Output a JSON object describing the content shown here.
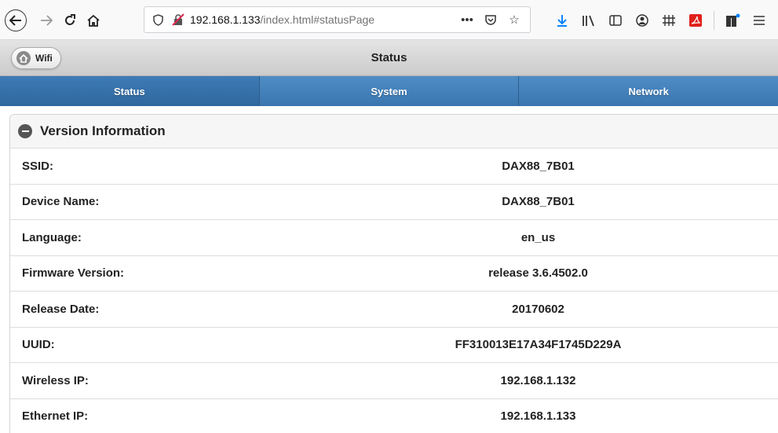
{
  "browser": {
    "url_host": "192.168.1.133",
    "url_path": "/index.html#statusPage",
    "icons": [
      "back-icon",
      "forward-icon",
      "reload-icon",
      "home-icon",
      "tracking-shield-icon",
      "insecure-connection-icon",
      "page-actions-icon",
      "pocket-icon",
      "bookmark-star-icon",
      "download-icon",
      "library-icon",
      "sidebar-icon",
      "account-icon",
      "extension-grid-icon",
      "pdf-extension-icon",
      "extensions-icon",
      "menu-icon"
    ]
  },
  "header": {
    "wifi_button": "Wifi",
    "title": "Status"
  },
  "navbar": {
    "tabs": [
      {
        "label": "Status",
        "active": true
      },
      {
        "label": "System",
        "active": false
      },
      {
        "label": "Network",
        "active": false
      }
    ]
  },
  "panel": {
    "title": "Version Information",
    "rows": [
      {
        "label": "SSID:",
        "value": "DAX88_7B01"
      },
      {
        "label": "Device Name:",
        "value": "DAX88_7B01"
      },
      {
        "label": "Language:",
        "value": "en_us"
      },
      {
        "label": "Firmware Version:",
        "value": "release 3.6.4502.0"
      },
      {
        "label": "Release Date:",
        "value": "20170602"
      },
      {
        "label": "UUID:",
        "value": "FF310013E17A34F1745D229A"
      },
      {
        "label": "Wireless IP:",
        "value": "192.168.1.132"
      },
      {
        "label": "Ethernet IP:",
        "value": "192.168.1.133"
      }
    ]
  },
  "colors": {
    "navbar": "#3f7db7",
    "header_bg": "#d6d6d6",
    "download_accent": "#0a84ff"
  }
}
